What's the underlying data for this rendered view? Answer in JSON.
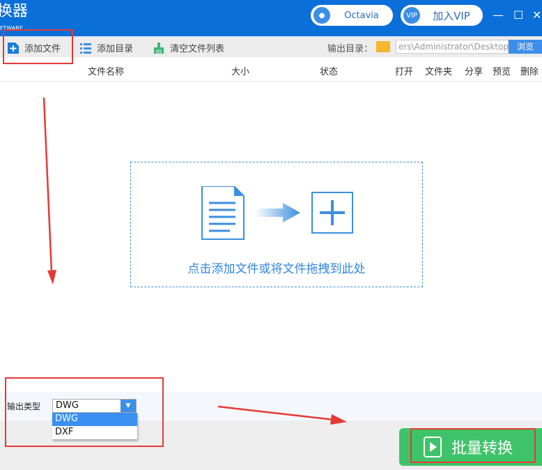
{
  "header": {
    "title": "换器",
    "subtitle": "FTWARE",
    "user": "Octavia",
    "vip_badge": "VIP",
    "vip_label": "加入VIP",
    "minimize": "—",
    "maximize": "☐",
    "close": "✕"
  },
  "toolbar": {
    "add_file": "添加文件",
    "add_dir": "添加目录",
    "clear": "清空文件列表",
    "output_dir_label": "输出目录：",
    "output_path": "ers\\Administrator\\Desktop",
    "browse": "浏览"
  },
  "columns": [
    "文件名称",
    "大小",
    "状态",
    "打开",
    "文件夹",
    "分享",
    "预览",
    "删除"
  ],
  "dropzone": {
    "text": "点击添加文件或将文件拖拽到此处"
  },
  "output_type": {
    "label": "输出类型",
    "selected": "DWG",
    "options": [
      "DWG",
      "DXF"
    ]
  },
  "convert_button": "批量转换",
  "colors": {
    "accent": "#0a6fd8",
    "convert": "#3fc36a",
    "annotation": "#e53935"
  }
}
